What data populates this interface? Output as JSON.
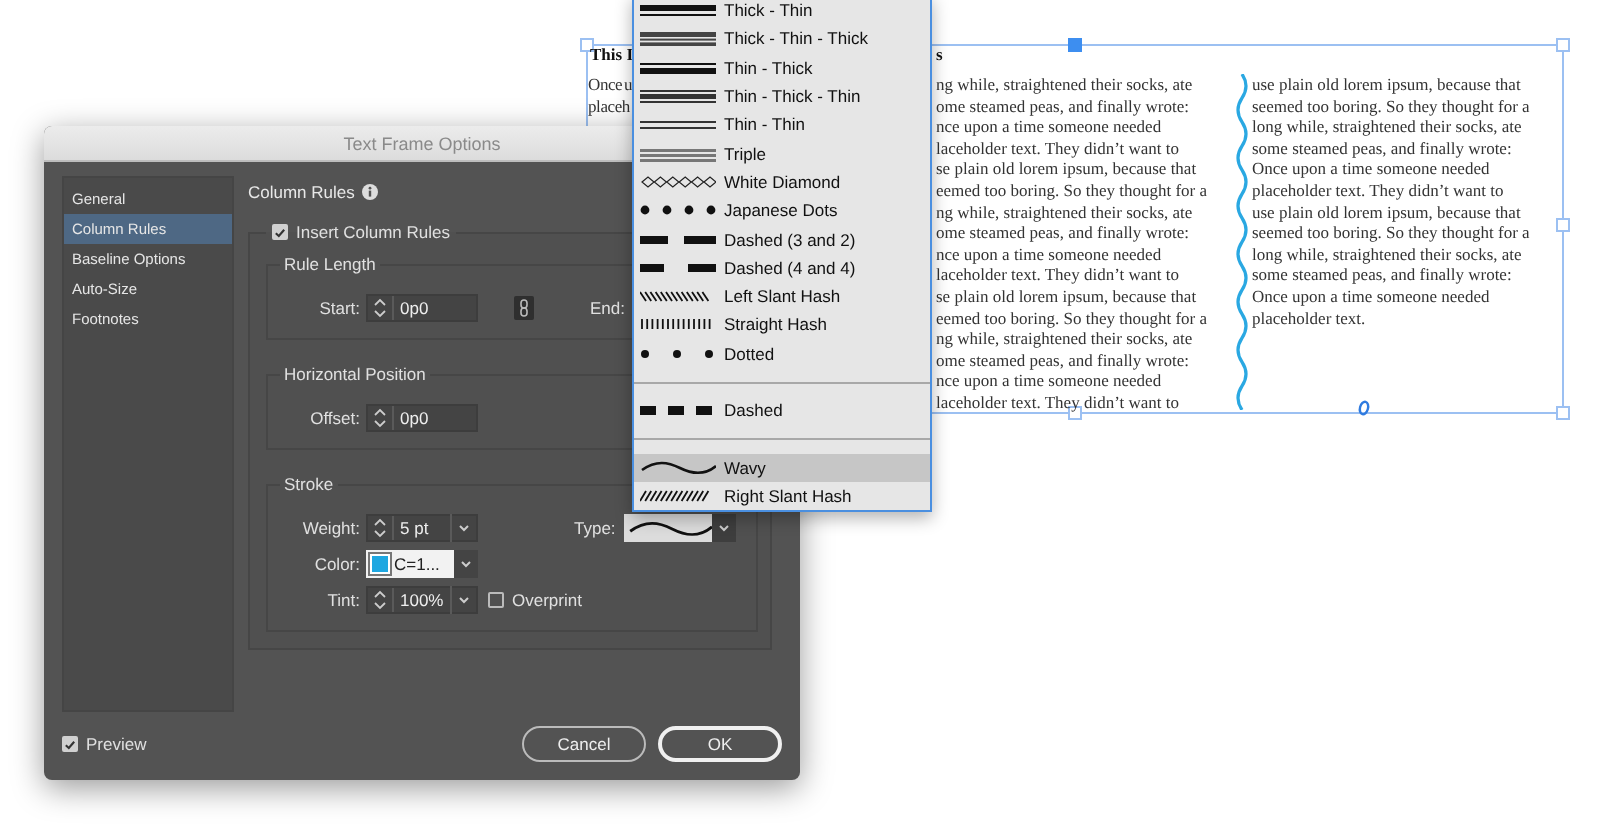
{
  "document": {
    "heading_parts": [
      "This I",
      "s"
    ],
    "column_1": [
      "Once u",
      "placeh"
    ],
    "column_2": [
      "ng while, straightened their socks, ate",
      "ome steamed peas, and finally wrote:",
      "nce upon a time someone needed",
      "laceholder text. They didn’t want to",
      "se plain old lorem ipsum, because that",
      "eemed too boring. So they thought for a",
      "ng while, straightened their socks, ate",
      "ome steamed peas, and finally wrote:",
      "nce upon a time someone needed",
      "laceholder text. They didn’t want to",
      "se plain old lorem ipsum, because that",
      "eemed too boring. So they thought for a",
      "ng while, straightened their socks, ate",
      "ome steamed peas, and finally wrote:",
      "nce upon a time someone needed",
      "laceholder text. They didn’t want to"
    ],
    "column_3": [
      "use plain old lorem ipsum, because that",
      "seemed too boring. So they thought for a",
      "long while, straightened their socks, ate",
      "some steamed peas, and finally wrote:",
      "Once upon a time someone needed",
      "placeholder text. They didn’t want to",
      "use plain old lorem ipsum, because that",
      "seemed too boring. So they thought for a",
      "long while, straightened their socks, ate",
      "some steamed peas, and finally wrote:",
      "Once upon a time someone needed",
      "placeholder text."
    ]
  },
  "dialog": {
    "title": "Text Frame Options",
    "sidebar": [
      {
        "label": "General",
        "selected": false
      },
      {
        "label": "Column Rules",
        "selected": true
      },
      {
        "label": "Baseline Options",
        "selected": false
      },
      {
        "label": "Auto-Size",
        "selected": false
      },
      {
        "label": "Footnotes",
        "selected": false
      }
    ],
    "section_title": "Column Rules",
    "insert": {
      "label": "Insert Column Rules",
      "checked": true
    },
    "rule_length": {
      "title": "Rule Length",
      "start_label": "Start:",
      "start_value": "0p0",
      "end_label": "End:"
    },
    "horizontal_position": {
      "title": "Horizontal Position",
      "offset_label": "Offset:",
      "offset_value": "0p0"
    },
    "stroke": {
      "title": "Stroke",
      "weight_label": "Weight:",
      "weight_value": "5 pt",
      "type_label": "Type:",
      "color_label": "Color:",
      "color_value": "C=1...",
      "tint_label": "Tint:",
      "tint_value": "100%",
      "overprint": {
        "label": "Overprint",
        "checked": false
      }
    },
    "preview": {
      "label": "Preview",
      "checked": true
    },
    "buttons": [
      {
        "label": "Cancel",
        "kind": "secondary"
      },
      {
        "label": "OK",
        "kind": "default"
      }
    ]
  },
  "type_menu": {
    "groups": [
      [
        {
          "label": "Thick - Thin",
          "kind": "thickthin",
          "selected": false
        },
        {
          "label": "Thick - Thin - Thick",
          "kind": "thickthinthick",
          "selected": false
        },
        {
          "label": "Thin - Thick",
          "kind": "thinthick",
          "selected": false
        },
        {
          "label": "Thin - Thick - Thin",
          "kind": "thinthickthin",
          "selected": false
        },
        {
          "label": "Thin - Thin",
          "kind": "thinthin",
          "selected": false
        },
        {
          "label": "Triple",
          "kind": "triple",
          "selected": false
        },
        {
          "label": "White Diamond",
          "kind": "diamond",
          "selected": false
        },
        {
          "label": "Japanese Dots",
          "kind": "japanesedots",
          "selected": false
        },
        {
          "label": "Dashed (3 and 2)",
          "kind": "dashed32",
          "selected": false
        },
        {
          "label": "Dashed (4 and 4)",
          "kind": "dashed44",
          "selected": false
        },
        {
          "label": "Left Slant Hash",
          "kind": "leftslant",
          "selected": false
        },
        {
          "label": "Straight Hash",
          "kind": "straighthash",
          "selected": false
        },
        {
          "label": "Dotted",
          "kind": "dotted",
          "selected": false
        }
      ],
      [
        {
          "label": "Dashed",
          "kind": "dashed",
          "selected": false
        }
      ],
      [
        {
          "label": "Wavy",
          "kind": "wavy",
          "selected": true
        },
        {
          "label": "Right Slant Hash",
          "kind": "rightslant",
          "selected": false
        }
      ]
    ]
  }
}
